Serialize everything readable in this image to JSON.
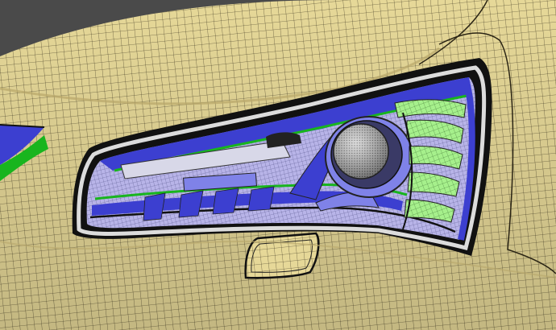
{
  "scene": {
    "subject": "car-headlight-wireframe-render",
    "colors": {
      "background": "#4a4a4a",
      "body": "#e6d898",
      "body_shade": "#c9b877",
      "mesh_line": "#2a2414",
      "housing_dark": "#111111",
      "trim_silver": "#dcdcdc",
      "blue_panel": "#3c3fd0",
      "blue_light": "#7f82e8",
      "lavender": "#b8b4e8",
      "green": "#18b51e",
      "light_green": "#a6f08c",
      "lens_grey": "#c8c8c8",
      "lens_dark": "#6a6a6a"
    }
  }
}
